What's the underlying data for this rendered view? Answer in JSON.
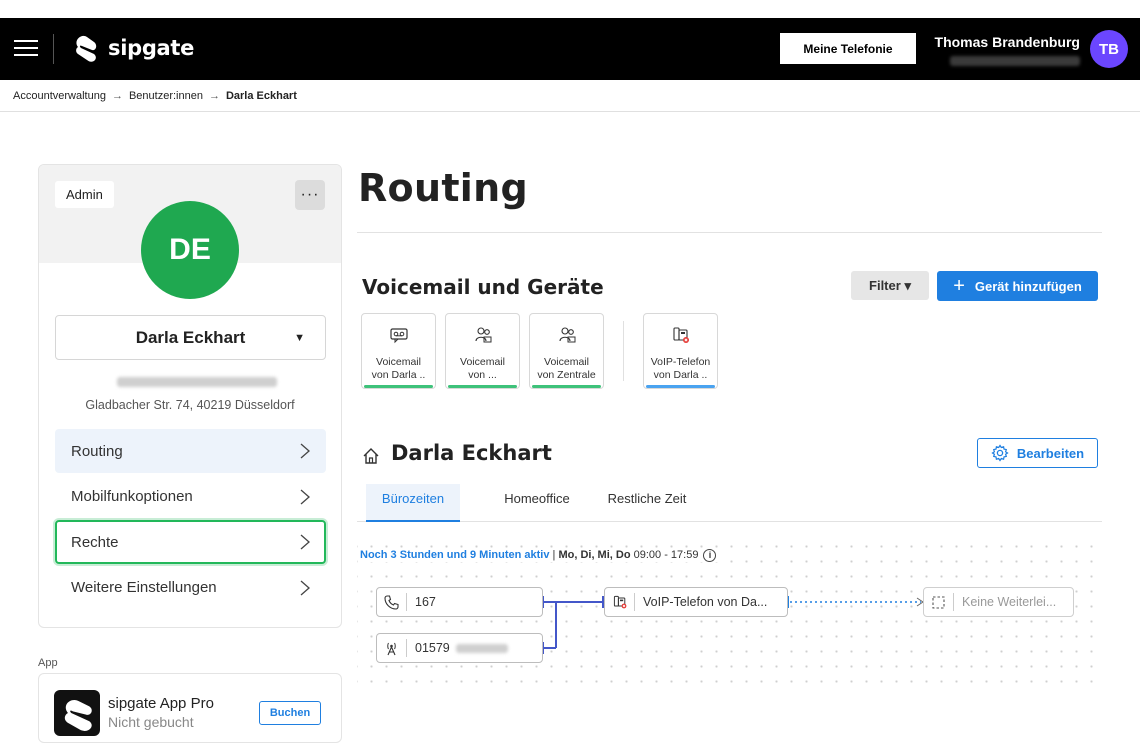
{
  "header": {
    "logo_text": "sipgate",
    "meine_button": "Meine Telefonie",
    "user_name": "Thomas Brandenburg",
    "user_initials": "TB"
  },
  "breadcrumb": {
    "items": [
      "Accountverwaltung",
      "Benutzer:innen",
      "Darla Eckhart"
    ]
  },
  "sidebar": {
    "role_badge": "Admin",
    "initials": "DE",
    "user_name": "Darla Eckhart",
    "address": "Gladbacher Str. 74, 40219 Düsseldorf",
    "nav": [
      {
        "label": "Routing"
      },
      {
        "label": "Mobilfunkoptionen"
      },
      {
        "label": "Rechte"
      },
      {
        "label": "Weitere Einstellungen"
      }
    ],
    "app_section_label": "App",
    "app_card": {
      "title": "sipgate App Pro",
      "subtitle": "Nicht gebucht",
      "button": "Buchen"
    }
  },
  "main": {
    "page_title": "Routing",
    "section_title": "Voicemail und Geräte",
    "filter_button": "Filter",
    "add_button": "Gerät hinzufügen",
    "devices": [
      {
        "line1": "Voicemail",
        "line2": "von Darla ..",
        "icon": "voicemail-icon"
      },
      {
        "line1": "Voicemail",
        "line2": "von ...",
        "icon": "group-icon"
      },
      {
        "line1": "Voicemail",
        "line2": "von Zentrale",
        "icon": "group-icon"
      },
      {
        "line1": "VoIP-Telefon",
        "line2": "von Darla ..",
        "icon": "voip-phone-icon"
      }
    ],
    "routing_owner": "Darla Eckhart",
    "edit_button": "Bearbeiten",
    "tabs": [
      "Bürozeiten",
      "Homeoffice",
      "Restliche Zeit"
    ],
    "status": {
      "active_text": "Noch 3 Stunden und 9 Minuten aktiv",
      "separator": " | ",
      "days": "Mo, Di, Mi, Do",
      "time": " 09:00 - 17:59",
      "info": "i"
    },
    "nodes": {
      "number1": "167",
      "number2": "01579",
      "device": "VoIP-Telefon von Da...",
      "forward": "Keine Weiterlei..."
    }
  },
  "colors": {
    "accent": "#1f7fe0",
    "avatar_tb": "#6b46ff",
    "avatar_de": "#1fa850",
    "voicemail_bar": "#3ec27a",
    "device_bar": "#4aa3f0",
    "focus": "#22b85a"
  }
}
